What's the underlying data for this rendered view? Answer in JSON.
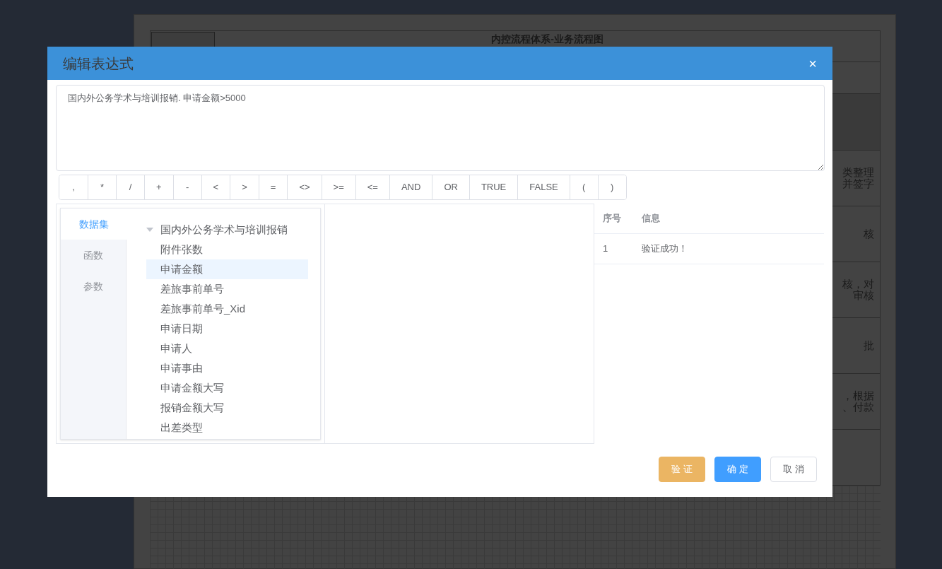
{
  "background_page": {
    "title": "内控流程体系-业务流程图",
    "rows": [
      {
        "lines": [
          "类整理",
          "并签字"
        ]
      },
      {
        "lines": [
          "核"
        ]
      },
      {
        "lines": [
          "核，对",
          "审核"
        ]
      },
      {
        "lines": [
          "批"
        ]
      },
      {
        "lines": [
          "，根据",
          "、付款"
        ]
      },
      {
        "lines": []
      }
    ]
  },
  "dialog": {
    "title": "编辑表达式",
    "close": "×",
    "expression": "国内外公务学术与培训报销. 申请金额>5000",
    "operators": [
      ",",
      "*",
      "/",
      "+",
      "-",
      "<",
      ">",
      "=",
      "<>",
      ">=",
      "<=",
      "AND",
      "OR",
      "TRUE",
      "FALSE",
      "(",
      ")"
    ],
    "tabs": [
      {
        "label": "数据集",
        "selected": true
      },
      {
        "label": "函数",
        "selected": false
      },
      {
        "label": "参数",
        "selected": false
      }
    ],
    "tree": [
      {
        "label": "国内外公务学术与培训报销",
        "expanded": true,
        "selected": false,
        "children": [
          {
            "label": "附件张数",
            "selected": false
          },
          {
            "label": "申请金额",
            "selected": true
          },
          {
            "label": "差旅事前单号",
            "selected": false
          },
          {
            "label": "差旅事前单号_Xid",
            "selected": false
          },
          {
            "label": "申请日期",
            "selected": false
          },
          {
            "label": "申请人",
            "selected": false
          },
          {
            "label": "申请事由",
            "selected": false
          },
          {
            "label": "申请金额大写",
            "selected": false
          },
          {
            "label": "报销金额大写",
            "selected": false
          },
          {
            "label": "出差类型",
            "selected": false
          }
        ]
      }
    ],
    "results": {
      "columns": [
        "序号",
        "信息"
      ],
      "rows": [
        [
          "1",
          "验证成功！"
        ]
      ]
    },
    "buttons": [
      {
        "label": "验 证",
        "kind": "warning"
      },
      {
        "label": "确 定",
        "kind": "primary"
      },
      {
        "label": "取 消",
        "kind": "default"
      }
    ]
  }
}
